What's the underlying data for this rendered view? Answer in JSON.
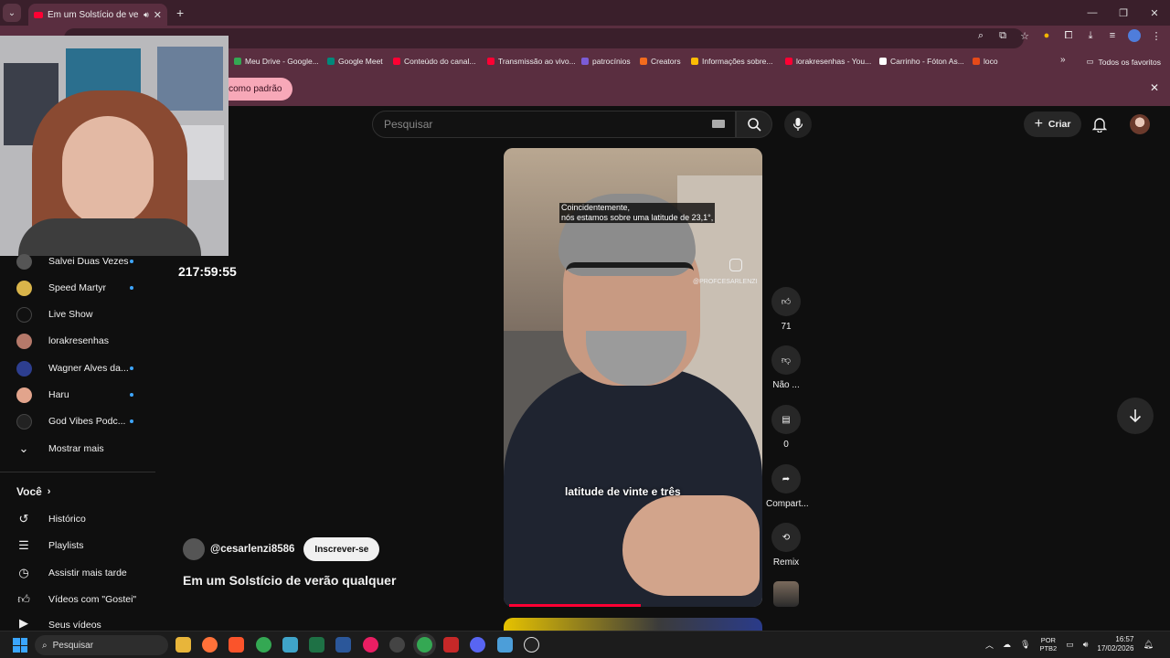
{
  "browser": {
    "tab_title": "Em um Solstício de verão q",
    "bookmarks": [
      {
        "label": "Meu Drive - Google...",
        "color": "#34a853"
      },
      {
        "label": "Google Meet",
        "color": "#00897b"
      },
      {
        "label": "Conteúdo do canal...",
        "color": "#ff0033"
      },
      {
        "label": "Transmissão ao vivo...",
        "color": "#ff0033"
      },
      {
        "label": "patrocínios",
        "color": "#7b5cd6"
      },
      {
        "label": "Creators",
        "color": "#f26b1d"
      },
      {
        "label": "Informações sobre...",
        "color": "#fbbc04"
      },
      {
        "label": "lorakresenhas - You...",
        "color": "#ff0033"
      },
      {
        "label": "Carrinho - Fóton As...",
        "color": "#ffffff"
      },
      {
        "label": "loco",
        "color": "#e64a19"
      }
    ],
    "all_bookmarks": "Todos os favoritos",
    "infobar_button": "inir como padrão"
  },
  "youtube": {
    "search_placeholder": "Pesquisar",
    "create_label": "Criar"
  },
  "sidebar": {
    "subscriptions": [
      {
        "label": "Salvei Duas Vezes",
        "dot": true,
        "avatar": "#555"
      },
      {
        "label": "Speed Martyr",
        "dot": true,
        "avatar": "#d9b44a"
      },
      {
        "label": "Live Show",
        "dot": false,
        "avatar": "#111"
      },
      {
        "label": "lorakresenhas",
        "dot": false,
        "avatar": "#b5796a"
      },
      {
        "label": "Wagner Alves da...",
        "dot": true,
        "avatar": "#2d3e8f"
      },
      {
        "label": "Haru",
        "dot": true,
        "avatar": "#e2a48c"
      },
      {
        "label": "God Vibes Podc...",
        "dot": true,
        "avatar": "#222"
      }
    ],
    "show_more": "Mostrar mais",
    "you_section": "Você",
    "you_items": [
      {
        "label": "Histórico",
        "icon": "history-icon"
      },
      {
        "label": "Playlists",
        "icon": "playlists-icon"
      },
      {
        "label": "Assistir mais tarde",
        "icon": "clock-icon"
      },
      {
        "label": "Vídeos com \"Gostei\"",
        "icon": "thumbs-up-icon"
      },
      {
        "label": "Seus vídeos",
        "icon": "your-videos-icon"
      }
    ]
  },
  "short": {
    "timer": "217:59:55",
    "caption_top_line1": "Coincidentemente,",
    "caption_top_line2": "nós estamos sobre uma latitude de 23,1°,",
    "caption_main": "latitude de vinte e três",
    "watermark": "@PROFCESARLENZI",
    "channel": "@cesarlenzi8586",
    "subscribe": "Inscrever-se",
    "title": "Em um Solstício de verão qualquer",
    "likes": "71",
    "dislike_label": "Não ...",
    "comments": "0",
    "share_label": "Compart...",
    "remix_label": "Remix",
    "progress": 0.51
  },
  "taskbar": {
    "search_label": "Pesquisar",
    "lang_line1": "POR",
    "lang_line2": "PTB2",
    "time": "16:57",
    "date": "17/02/2026"
  }
}
